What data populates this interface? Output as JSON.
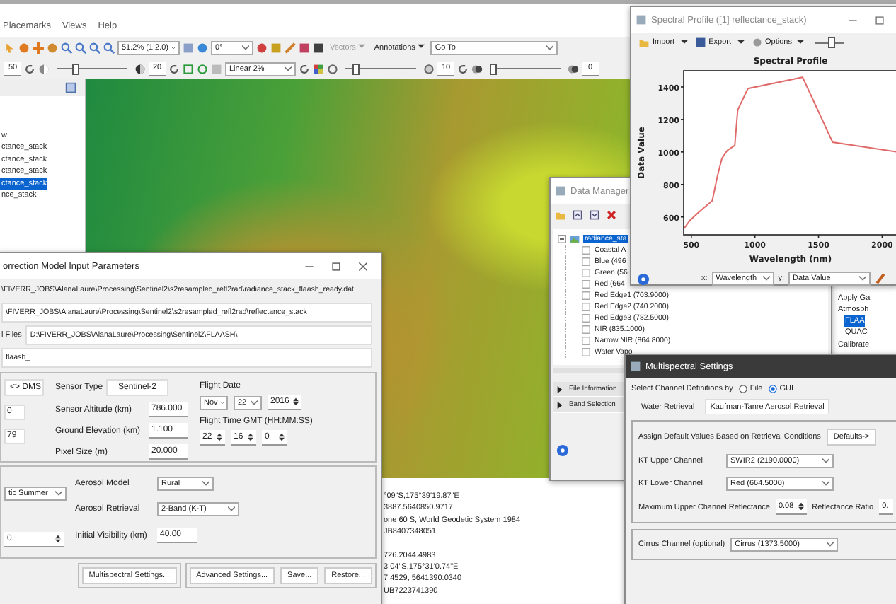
{
  "menu": [
    "Placemarks",
    "Views",
    "Help"
  ],
  "toolbar": {
    "zoom": "51.2% (1:2.0)",
    "rotation": "0°",
    "vectors": "Vectors",
    "annotations": "Annotations",
    "go_to": "Go To"
  },
  "brightness": {
    "value": "50"
  },
  "contrast": {
    "level": 0.25,
    "value": "20"
  },
  "stretch": "Linear 2%",
  "sharpen": {
    "level": 0.1,
    "value": "10"
  },
  "transparency": {
    "level": 0.0,
    "value": "0"
  },
  "layers": [
    {
      "label": "w",
      "selected": false
    },
    {
      "label": "ctance_stack",
      "selected": false
    },
    {
      "label": "ctance_stack",
      "selected": false
    },
    {
      "label": "ctance_stack",
      "selected": false
    },
    {
      "label": "ctance_stack",
      "selected": true
    },
    {
      "label": "nce_stack",
      "selected": false
    }
  ],
  "flaash": {
    "title": "orrection Model Input Parameters",
    "input_file": "\\FIVERR_JOBS\\AlanaLaure\\Processing\\Sentinel2\\s2resampled_refl2rad\\radiance_stack_flaash_ready.dat",
    "output_file": "\\FIVERR_JOBS\\AlanaLaure\\Processing\\Sentinel2\\s2resampled_refl2rad\\reflectance_stack",
    "output_dir_label": "l Files",
    "output_dir": "D:\\FIVERR_JOBS\\AlanaLaure\\Processing\\Sentinel2\\FLAASH\\",
    "rootname": "flaash_",
    "dms_button": "<> DMS",
    "lat": "0",
    "lon": "79",
    "sensor_type_label": "Sensor Type",
    "sensor_type": "Sentinel-2",
    "sensor_fields": [
      {
        "label": "Sensor Altitude (km)",
        "value": "786.000"
      },
      {
        "label": "Ground Elevation (km)",
        "value": "1.100"
      },
      {
        "label": "Pixel Size (m)",
        "value": "20.000"
      }
    ],
    "flight_date_label": "Flight Date",
    "flight_date": [
      {
        "kind": "dropdown",
        "value": "Nov"
      },
      {
        "kind": "dropdown",
        "value": "22"
      },
      {
        "kind": "spinner",
        "value": "2016"
      }
    ],
    "flight_time_label": "Flight Time GMT (HH:MM:SS)",
    "flight_time": [
      "22",
      "16",
      "0"
    ],
    "atmosphere_model": "tic Summer",
    "aerosol_model_label": "Aerosol Model",
    "aerosol_model": "Rural",
    "aerosol_retrieval_label": "Aerosol Retrieval",
    "aerosol_retrieval": "2-Band (K-T)",
    "water_column": "0",
    "visibility_label": "Initial Visibility (km)",
    "visibility": "40.00",
    "buttons": [
      "Multispectral Settings...",
      "Advanced Settings...",
      "Save...",
      "Restore..."
    ]
  },
  "cursor_info": [
    "°09\"S,175°39'19.87\"E",
    "3887.5640850.9717",
    "one 60 S, World Geodetic System 1984",
    "JB8407348051",
    "726.2044.4983",
    "3.04\"S,175°31'0.74\"E",
    "7.4529, 5641390.0340",
    "UB7223741390"
  ],
  "data_manager": {
    "title": "Data Manager",
    "root": {
      "label": "radiance_sta",
      "selected": true,
      "expanded": true
    },
    "bands": [
      {
        "label": "Coastal A",
        "checked": false
      },
      {
        "label": "Blue (496",
        "checked": false
      },
      {
        "label": "Green (56",
        "checked": false
      },
      {
        "label": "Red (664",
        "checked": false
      },
      {
        "label": "Red Edge1 (703.9000)",
        "checked": false
      },
      {
        "label": "Red Edge2 (740.2000)",
        "checked": false
      },
      {
        "label": "Red Edge3 (782.5000)",
        "checked": false
      },
      {
        "label": "NIR (835.1000)",
        "checked": false
      },
      {
        "label": "Narrow NIR (864.8000)",
        "checked": false
      },
      {
        "label": "Water Vapo",
        "checked": false
      }
    ],
    "sections": [
      {
        "label": "File Information",
        "expanded": false
      },
      {
        "label": "Band Selection",
        "expanded": false
      }
    ]
  },
  "toolbox": [
    {
      "label": "Apply Ga",
      "selected": false
    },
    {
      "label": "Atmosph",
      "selected": false,
      "children": [
        {
          "label": "FLAA",
          "selected": true
        },
        {
          "label": "QUAC",
          "selected": false
        }
      ]
    },
    {
      "label": "Calibrate",
      "selected": false
    }
  ],
  "spectral_profile": {
    "title": "Spectral Profile ([1] reflectance_stack)",
    "menus": [
      "Import",
      "Export",
      "Options"
    ],
    "line_width": {
      "level": 0.55
    },
    "chart_data": {
      "type": "line",
      "title": "Spectral Profile",
      "xlabel": "Wavelength (nm)",
      "ylabel": "Data Value",
      "x": [
        443,
        490,
        560,
        665,
        705,
        740,
        783,
        842,
        865,
        945,
        1375,
        1610,
        2120
      ],
      "series": [
        {
          "color": "#e06a6a",
          "values": [
            530,
            580,
            630,
            700,
            850,
            960,
            1010,
            1040,
            1260,
            1390,
            1460,
            1060,
            1000
          ]
        }
      ],
      "xlim": [
        440,
        2120
      ],
      "ylim": [
        490,
        1500
      ],
      "xticks": [
        500,
        1000,
        1500,
        2000
      ],
      "yticks": [
        600,
        800,
        1000,
        1200,
        1400
      ]
    },
    "x_label": "x:",
    "x_axis": "Wavelength",
    "y_label": "y:",
    "y_axis": "Data Value"
  },
  "multispectral": {
    "title": "Multispectral Settings",
    "channel_def_label": "Select Channel Definitions by",
    "channel_def_options": [
      {
        "label": "File",
        "selected": false
      },
      {
        "label": "GUI",
        "selected": true
      }
    ],
    "tabs": [
      {
        "label": "Water Retrieval",
        "selected": false
      },
      {
        "label": "Kaufman-Tanre Aerosol Retrieval",
        "selected": true
      }
    ],
    "defaults_label": "Assign Default Values Based on Retrieval Conditions",
    "defaults_button": "Defaults->",
    "upper_label": "KT Upper Channel",
    "upper": "SWIR2 (2190.0000)",
    "lower_label": "KT Lower Channel",
    "lower": "Red (664.5000)",
    "max_refl_label": "Maximum Upper Channel Reflectance",
    "max_refl": "0.08",
    "ratio_label": "Reflectance Ratio",
    "ratio": "0.",
    "cirrus_label": "Cirrus Channel (optional)",
    "cirrus": "Cirrus (1373.5000)"
  }
}
